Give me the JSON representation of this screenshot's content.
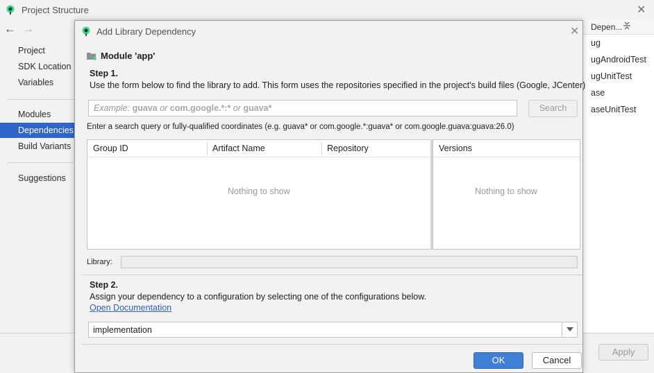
{
  "background_window": {
    "title": "Project Structure",
    "sidebar": {
      "items": [
        {
          "label": "Project"
        },
        {
          "label": "SDK Location"
        },
        {
          "label": "Variables"
        },
        {
          "label": "Modules"
        },
        {
          "label": "Dependencies",
          "selected": true
        },
        {
          "label": "Build Variants"
        },
        {
          "label": "Suggestions"
        }
      ]
    },
    "right_panel": {
      "header": "Depen...",
      "items": [
        "ug",
        "ugAndroidTest",
        "ugUnitTest",
        "ase",
        "aseUnitTest"
      ]
    },
    "apply_label": "Apply"
  },
  "dialog": {
    "title": "Add Library Dependency",
    "module_label": "Module 'app'",
    "step1": {
      "title": "Step 1.",
      "description": "Use the form below to find the library to add. This form uses the repositories specified in the project's build files (Google, JCenter)"
    },
    "search": {
      "placeholder_prefix": "Example: ",
      "placeholder_a": "guava",
      "placeholder_or1": " or ",
      "placeholder_b": "com.google.*:*",
      "placeholder_or2": " or ",
      "placeholder_c": "guava*",
      "button_label": "Search"
    },
    "hint": "Enter a search query or fully-qualified coordinates (e.g. guava* or com.google.*:guava* or com.google.guava:guava:26.0)",
    "results_table": {
      "columns": [
        "Group ID",
        "Artifact Name",
        "Repository"
      ],
      "empty_text": "Nothing to show"
    },
    "versions_table": {
      "columns": [
        "Versions"
      ],
      "empty_text": "Nothing to show"
    },
    "library_label": "Library:",
    "library_value": "",
    "step2": {
      "title": "Step 2.",
      "description": "Assign your dependency to a configuration by selecting one of the configurations below.",
      "doc_link": "Open Documentation"
    },
    "configuration": {
      "selected": "implementation"
    },
    "ok_label": "OK",
    "cancel_label": "Cancel"
  },
  "colors": {
    "accent": "#2f65ca",
    "ok_button": "#3f7fd6",
    "link": "#2f5fc8",
    "android_green": "#3ddc84"
  }
}
